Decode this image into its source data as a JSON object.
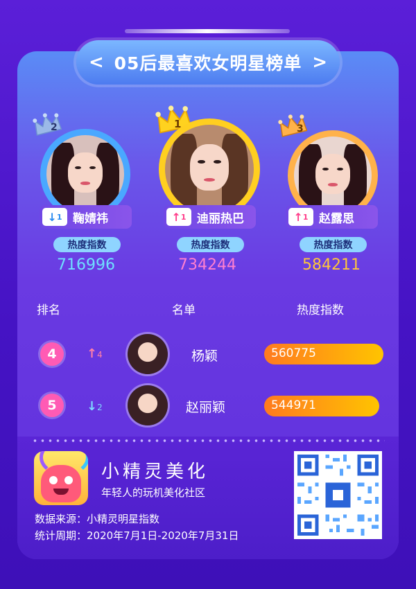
{
  "title": "05后最喜欢女明星榜单",
  "nav": {
    "prev": "<",
    "next": ">"
  },
  "top3": [
    {
      "rank": "2",
      "name": "鞠婧祎",
      "trend": "↓",
      "change": "1",
      "heat_label": "热度指数",
      "heat": "716996",
      "ring_color": "#4aa8ff",
      "heat_color": "#6fe0ff"
    },
    {
      "rank": "1",
      "name": "迪丽热巴",
      "trend": "↑",
      "change": "1",
      "heat_label": "热度指数",
      "heat": "734244",
      "ring_color": "#ffcf20",
      "heat_color": "#ff7fd0"
    },
    {
      "rank": "3",
      "name": "赵露思",
      "trend": "↑",
      "change": "1",
      "heat_label": "热度指数",
      "heat": "584211",
      "ring_color": "#ffb24a",
      "heat_color": "#ffc63a"
    }
  ],
  "table": {
    "headers": [
      "排名",
      "名单",
      "热度指数"
    ],
    "rows": [
      {
        "rank": "4",
        "trend": "↑",
        "change": "4",
        "name": "杨颖",
        "heat": "560775",
        "bar": 0.95,
        "trend_color": "#ff7fa8"
      },
      {
        "rank": "5",
        "trend": "↓",
        "change": "2",
        "name": "赵丽颖",
        "heat": "544971",
        "bar": 0.92,
        "trend_color": "#7fd8ff"
      }
    ]
  },
  "footer": {
    "brand": "小精灵美化",
    "slogan": "年轻人的玩机美化社区",
    "source": "数据来源：小精灵明星指数",
    "period": "统计周期：2020年7月1日-2020年7月31日"
  },
  "colors": {
    "down": "#2a8cf0",
    "up": "#ff3d8a",
    "bg": "#4a17c9"
  }
}
